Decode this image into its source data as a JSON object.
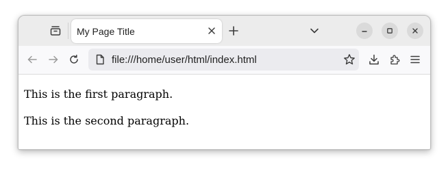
{
  "browser": {
    "tab": {
      "title": "My Page Title",
      "close_icon": "close-icon"
    },
    "tab_bar": {
      "tabs_overview_icon": "tabs-overview-icon",
      "new_tab_icon": "plus-icon",
      "list_all_tabs_icon": "chevron-down-icon"
    },
    "window_controls": [
      "minimize-icon",
      "maximize-icon",
      "close-icon"
    ],
    "navigation": {
      "back_icon": "arrow-left-icon",
      "forward_icon": "arrow-right-icon",
      "reload_icon": "reload-icon",
      "url": "file:///home/user/html/index.html",
      "page_icon": "document-icon",
      "bookmark_icon": "star-icon",
      "downloads_icon": "download-icon",
      "extensions_icon": "puzzle-icon",
      "menu_icon": "hamburger-menu-icon"
    }
  },
  "page": {
    "paragraphs": [
      "This is the first paragraph.",
      "This is the second paragraph."
    ]
  },
  "colors": {
    "tab_bar_bg": "#ececec",
    "nav_bar_bg": "#f9f9fb",
    "url_bar_bg": "#ebebef",
    "window_button_bg": "#dadada",
    "icon": "#3b3b3b"
  }
}
